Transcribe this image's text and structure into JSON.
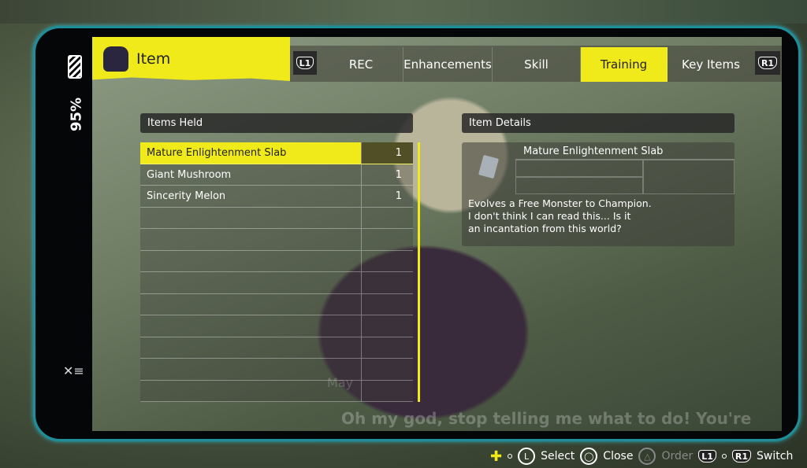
{
  "status": {
    "battery": "95%"
  },
  "header": {
    "title": "Item",
    "prev_button": "L1",
    "next_button": "R1",
    "tabs": [
      {
        "label": "REC"
      },
      {
        "label": "Enhancements"
      },
      {
        "label": "Skill"
      },
      {
        "label": "Training",
        "active": true
      },
      {
        "label": "Key Items"
      }
    ]
  },
  "items_held": {
    "title": "Items Held",
    "rows": [
      {
        "name": "Mature Enlightenment Slab",
        "count": "1",
        "selected": true
      },
      {
        "name": "Giant Mushroom",
        "count": "1"
      },
      {
        "name": "Sincerity Melon",
        "count": "1"
      }
    ]
  },
  "item_details": {
    "title": "Item Details",
    "name": "Mature Enlightenment Slab",
    "icon": "slab-icon",
    "description": [
      "Evolves a Free Monster to Champion.",
      "I don't think I can read this... Is it",
      "an incantation from this world?"
    ]
  },
  "dialogue": {
    "speaker": "May",
    "text": "Oh my god, stop telling me what to do! You're not the boss of me!"
  },
  "hints": {
    "select": "Select",
    "close": "Close",
    "order": "Order",
    "switch": "Switch",
    "l_stick": "L",
    "l1": "L1",
    "r1": "R1"
  },
  "colors": {
    "accent": "#f0ea1a",
    "frame": "#1e8f9a"
  }
}
